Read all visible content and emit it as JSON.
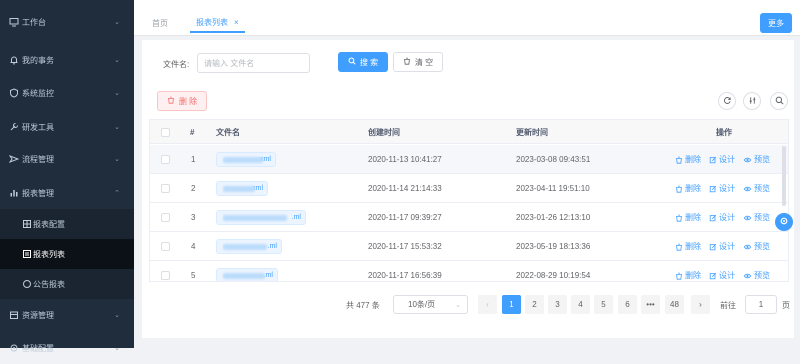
{
  "sidebar": {
    "items": [
      {
        "label": "工作台",
        "icon": "monitor-icon",
        "arrow": "⌄"
      },
      {
        "label": "我的事务",
        "icon": "bell-icon",
        "arrow": "⌄"
      },
      {
        "label": "系统监控",
        "icon": "shield-icon",
        "arrow": "⌄"
      },
      {
        "label": "研发工具",
        "icon": "wrench-icon",
        "arrow": "⌄"
      },
      {
        "label": "流程管理",
        "icon": "send-icon",
        "arrow": "⌄"
      },
      {
        "label": "报表管理",
        "icon": "chart-icon",
        "arrow": "⌃"
      }
    ],
    "sub_items": [
      {
        "label": "报表配置",
        "icon": "grid-icon"
      },
      {
        "label": "报表列表",
        "icon": "list-icon"
      },
      {
        "label": "公告报表",
        "icon": "circle-icon"
      }
    ],
    "bottom_items": [
      {
        "label": "资源管理",
        "icon": "box-icon",
        "arrow": "⌄"
      },
      {
        "label": "基础配置",
        "icon": "cog-icon",
        "arrow": "⌄"
      }
    ]
  },
  "tabs": [
    {
      "label": "首页"
    },
    {
      "label": "报表列表",
      "close": "×"
    }
  ],
  "more_label": "更多",
  "search": {
    "label": "文件名:",
    "placeholder": "请输入 文件名",
    "search_button": "搜 索",
    "clear_button": "清 空"
  },
  "toolbar": {
    "delete_button": "删 除"
  },
  "table": {
    "headers": {
      "index": "#",
      "file_name": "文件名",
      "created": "创建时间",
      "updated": "更新时间",
      "actions": "操作"
    },
    "rows": [
      {
        "index": "1",
        "file_suffix": ".xml",
        "created": "2020-11-13 10:41:27",
        "updated": "2023-03-08 09:43:51"
      },
      {
        "index": "2",
        "file_suffix": "xml",
        "created": "2020-11-14 21:14:33",
        "updated": "2023-04-11 19:51:10"
      },
      {
        "index": "3",
        "file_suffix": ".ml",
        "created": "2020-11-17 09:39:27",
        "updated": "2023-01-26 12:13:10"
      },
      {
        "index": "4",
        "file_suffix": ".ml",
        "created": "2020-11-17 15:53:32",
        "updated": "2023-05-19 18:13:36"
      },
      {
        "index": "5",
        "file_suffix": ".ml",
        "created": "2020-11-17 16:56:39",
        "updated": "2022-08-29 10:19:54"
      }
    ],
    "action_labels": {
      "delete": "删除",
      "design": "设计",
      "preview": "预览"
    }
  },
  "pagination": {
    "total": "共 477 条",
    "page_size": "10条/页",
    "prev": "‹",
    "next": "›",
    "pages": [
      "1",
      "2",
      "3",
      "4",
      "5",
      "6",
      "•••",
      "48"
    ],
    "current": "1",
    "goto_label": "前往",
    "goto_value": "1",
    "page_unit": "页"
  },
  "colors": {
    "sidebar_bg": "#1f2d3d",
    "primary": "#409eff",
    "danger": "#f56c6c"
  }
}
